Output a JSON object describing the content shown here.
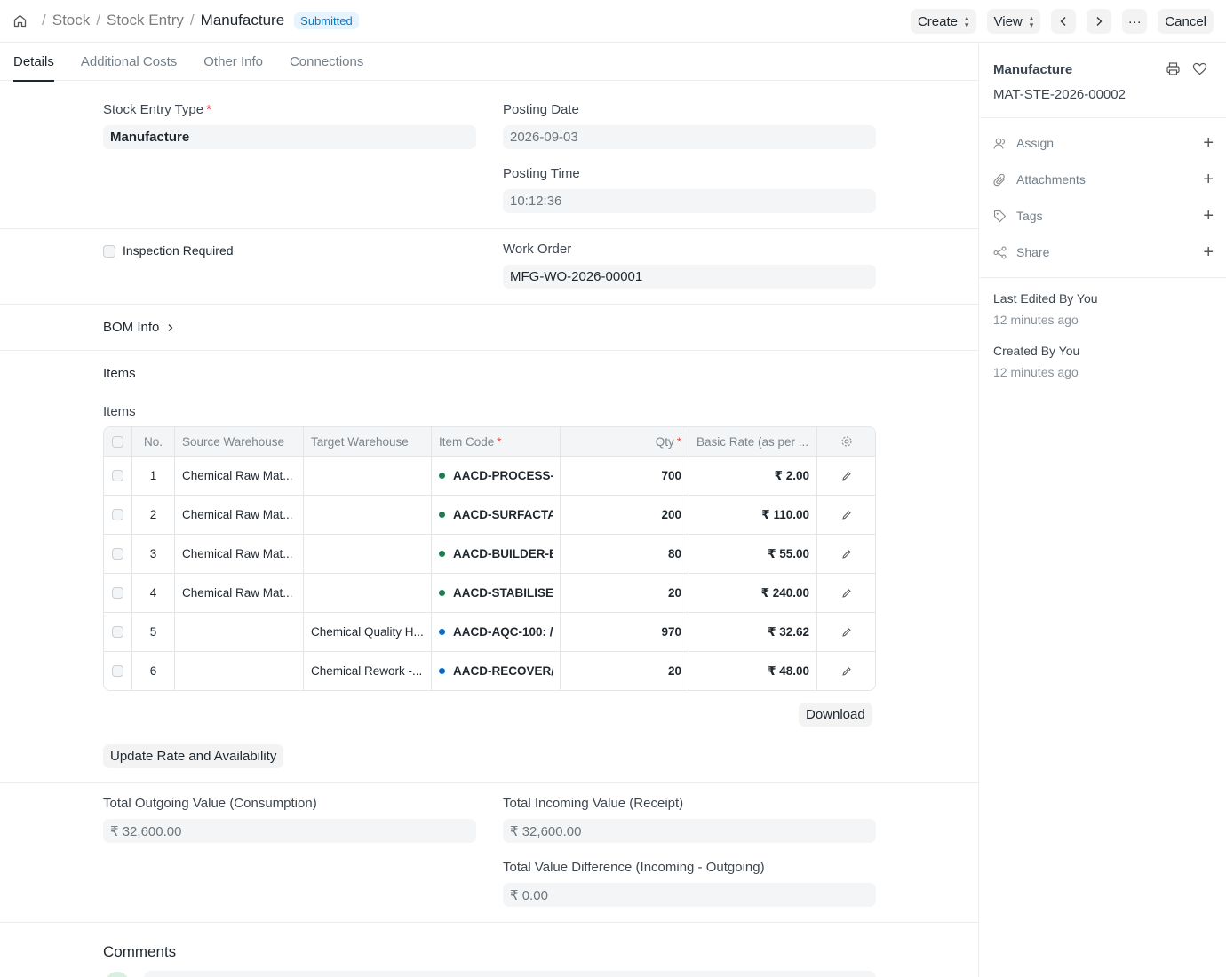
{
  "breadcrumb": {
    "items": [
      "Stock",
      "Stock Entry"
    ],
    "current": "Manufacture",
    "status": "Submitted"
  },
  "toolbar": {
    "create": "Create",
    "view": "View",
    "more": "···",
    "cancel": "Cancel"
  },
  "tabs": [
    "Details",
    "Additional Costs",
    "Other Info",
    "Connections"
  ],
  "form": {
    "stock_entry_type_label": "Stock Entry Type",
    "stock_entry_type": "Manufacture",
    "posting_date_label": "Posting Date",
    "posting_date": "2026-09-03",
    "posting_time_label": "Posting Time",
    "posting_time": "10:12:36",
    "inspection_label": "Inspection Required",
    "work_order_label": "Work Order",
    "work_order": "MFG-WO-2026-00001",
    "bom_info": "BOM Info",
    "items_section": "Items",
    "items_label": "Items"
  },
  "grid": {
    "headers": {
      "no": "No.",
      "source": "Source Warehouse",
      "target": "Target Warehouse",
      "item_code": "Item Code",
      "qty": "Qty",
      "rate": "Basic Rate (as per ..."
    },
    "rows": [
      {
        "no": "1",
        "source": "Chemical Raw Mat...",
        "target": "",
        "item_code": "AACD-PROCESS-",
        "qty": "700",
        "rate": "₹ 2.00",
        "dot": "#1e7a4f"
      },
      {
        "no": "2",
        "source": "Chemical Raw Mat...",
        "target": "",
        "item_code": "AACD-SURFACTA",
        "qty": "200",
        "rate": "₹ 110.00",
        "dot": "#1e7a4f"
      },
      {
        "no": "3",
        "source": "Chemical Raw Mat...",
        "target": "",
        "item_code": "AACD-BUILDER-E",
        "qty": "80",
        "rate": "₹ 55.00",
        "dot": "#1e7a4f"
      },
      {
        "no": "4",
        "source": "Chemical Raw Mat...",
        "target": "",
        "item_code": "AACD-STABILISEI",
        "qty": "20",
        "rate": "₹ 240.00",
        "dot": "#1e7a4f"
      },
      {
        "no": "5",
        "source": "",
        "target": "Chemical Quality H...",
        "item_code": "AACD-AQC-100: /",
        "qty": "970",
        "rate": "₹ 32.62",
        "dot": "#0b6bc4"
      },
      {
        "no": "6",
        "source": "",
        "target": "Chemical Rework -...",
        "item_code": "AACD-RECOVER/",
        "qty": "20",
        "rate": "₹ 48.00",
        "dot": "#0b6bc4"
      }
    ]
  },
  "buttons": {
    "download": "Download",
    "update_rate": "Update Rate and Availability"
  },
  "totals": {
    "outgoing_label": "Total Outgoing Value (Consumption)",
    "outgoing": "₹ 32,600.00",
    "incoming_label": "Total Incoming Value (Receipt)",
    "incoming": "₹ 32,600.00",
    "difference_label": "Total Value Difference (Incoming - Outgoing)",
    "difference": "₹ 0.00"
  },
  "comments_label": "Comments",
  "sidebar": {
    "title": "Manufacture",
    "docname": "MAT-STE-2026-00002",
    "items": [
      "Assign",
      "Attachments",
      "Tags",
      "Share"
    ],
    "last_edited": "Last Edited By You",
    "last_edited_time": "12 minutes ago",
    "created": "Created By You",
    "created_time": "12 minutes ago"
  }
}
